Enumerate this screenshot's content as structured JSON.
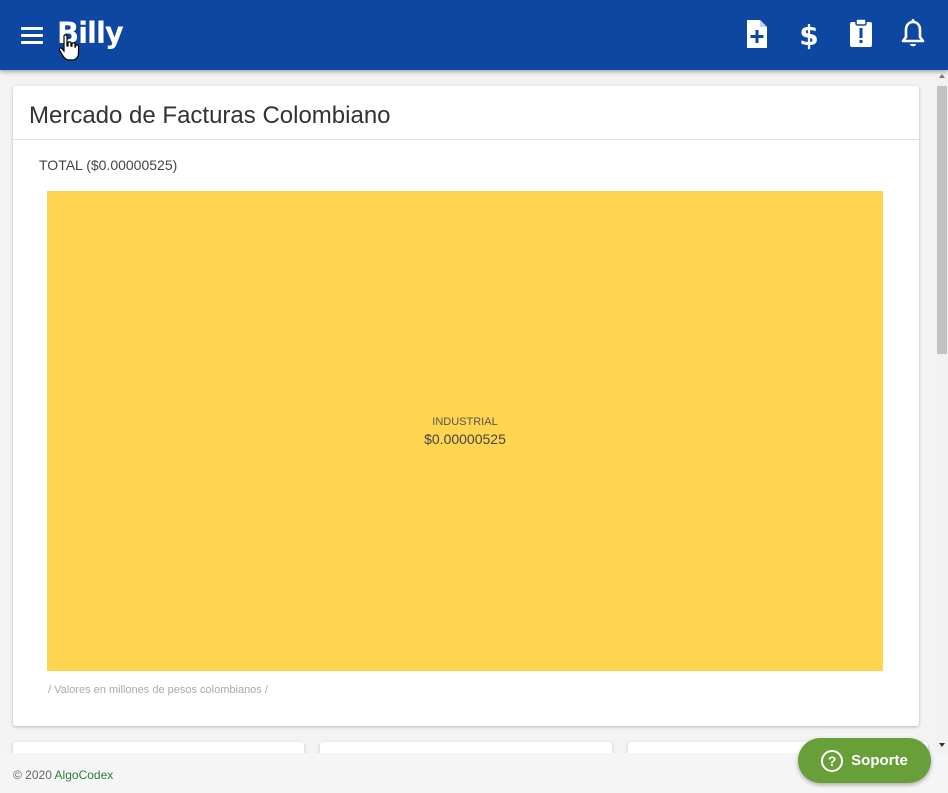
{
  "header": {
    "brand": "Billy",
    "icons": [
      "file-plus-icon",
      "dollar-icon",
      "clipboard-alert-icon",
      "bell-icon"
    ]
  },
  "card": {
    "title": "Mercado de Facturas Colombiano",
    "total_label": "TOTAL ($0.00000525)",
    "footnote": "/ Valores en millones de pesos colombianos /"
  },
  "chart_data": {
    "type": "treemap",
    "title": "",
    "nodes": [
      {
        "name": "INDUSTRIAL",
        "value_label": "$0.00000525",
        "value": 5.25e-06,
        "color": "#ffd54f"
      }
    ]
  },
  "footer": {
    "copyright_prefix": "© 2020 ",
    "company": "AlgoCodex"
  },
  "support": {
    "label": "Soporte"
  },
  "colors": {
    "header": "#0d47a1",
    "support": "#689f38",
    "treemap_fill": "#ffd54f"
  }
}
